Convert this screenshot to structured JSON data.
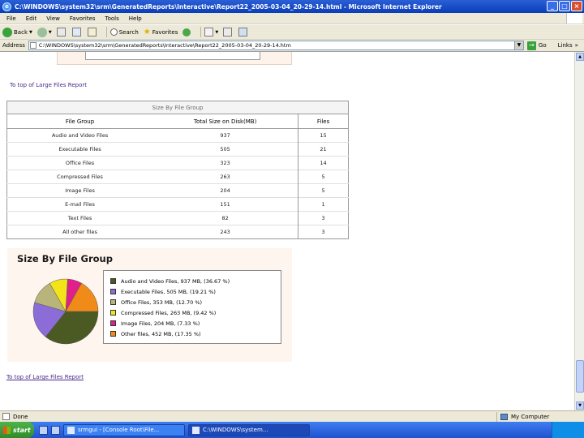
{
  "window": {
    "title": "C:\\WINDOWS\\system32\\srm\\GeneratedReports\\Interactive\\Report22_2005-03-04_20-29-14.html - Microsoft Internet Explorer"
  },
  "menu": [
    "File",
    "Edit",
    "View",
    "Favorites",
    "Tools",
    "Help"
  ],
  "toolbar": {
    "back": "Back",
    "search": "Search",
    "favorites": "Favorites"
  },
  "address": {
    "label": "Address",
    "value": "C:\\WINDOWS\\system32\\srm\\GeneratedReports\\Interactive\\Report22_2005-03-04_20-29-14.htm",
    "go": "Go",
    "links": "Links"
  },
  "content": {
    "top_link": "To top of Large Files Report",
    "bottom_link": "To top of Large Files Report",
    "table": {
      "caption": "Size By File Group",
      "headers": [
        "File Group",
        "Total Size on Disk(MB)",
        "Files"
      ],
      "rows": [
        [
          "Audio and Video Files",
          "937",
          "15"
        ],
        [
          "Executable Files",
          "505",
          "21"
        ],
        [
          "Office Files",
          "323",
          "14"
        ],
        [
          "Compressed Files",
          "263",
          "5"
        ],
        [
          "Image Files",
          "204",
          "5"
        ],
        [
          "E-mail Files",
          "151",
          "1"
        ],
        [
          "Text Files",
          "82",
          "3"
        ],
        [
          "All other files",
          "243",
          "3"
        ]
      ]
    },
    "chart": {
      "title": "Size By File Group"
    }
  },
  "chart_data": {
    "type": "pie",
    "title": "Size By File Group",
    "legend_position": "right",
    "slices": [
      {
        "label": "Audio and Video Files, 937 MB, (36.67 %)",
        "value": 36.67,
        "color": "#4a5a22"
      },
      {
        "label": "Executable Files, 505 MB, (19.21 %)",
        "value": 19.21,
        "color": "#8c6cd6"
      },
      {
        "label": "Office Files, 353 MB, (12.70 %)",
        "value": 12.7,
        "color": "#b8b47a"
      },
      {
        "label": "Compressed Files, 263 MB, (9.42 %)",
        "value": 9.42,
        "color": "#f2e418"
      },
      {
        "label": "Image Files, 204 MB, (7.33 %)",
        "value": 7.33,
        "color": "#e0208a"
      },
      {
        "label": "Other files, 452 MB, (17.35 %)",
        "value": 17.35,
        "color": "#f08a18"
      }
    ]
  },
  "status": {
    "left": "Done",
    "zone": "My Computer"
  },
  "taskbar": {
    "start": "start",
    "tasks": [
      "srmgui - [Console Root\\File...",
      "C:\\WINDOWS\\system..."
    ]
  }
}
